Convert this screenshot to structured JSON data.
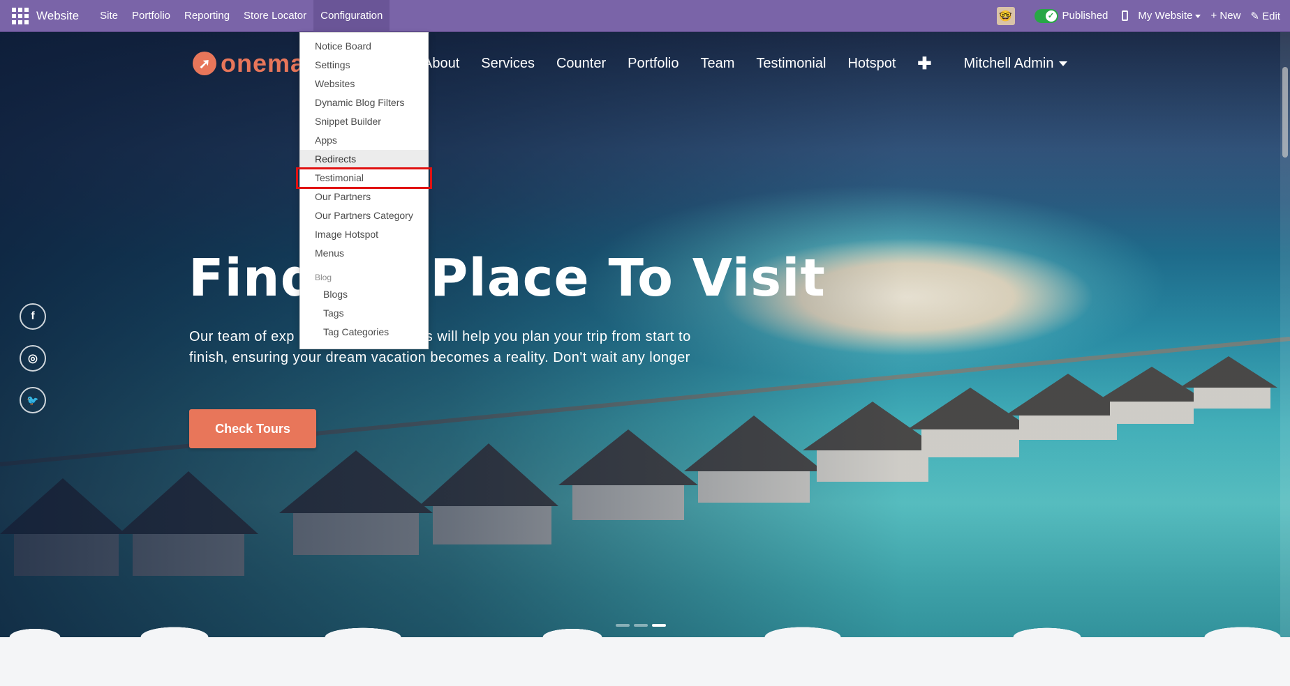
{
  "topbar": {
    "app_name": "Website",
    "nav": [
      "Site",
      "Portfolio",
      "Reporting",
      "Store Locator",
      "Configuration"
    ],
    "published_label": "Published",
    "website_selector": "My Website",
    "new_label": "+ New",
    "edit_label": "✎ Edit"
  },
  "site": {
    "logo_text": "onema",
    "nav": [
      "About",
      "Services",
      "Counter",
      "Portfolio",
      "Team",
      "Testimonial",
      "Hotspot"
    ],
    "add_label": "✚",
    "user": "Mitchell Admin"
  },
  "hero": {
    "title": "Find      Place To Visit",
    "text": "Our team of exp                         perts will help you plan your trip from start to finish, ensuring your dream vacation becomes a reality. Don't wait any longer",
    "cta": "Check Tours",
    "carousel_slides": 3,
    "active_slide": 3
  },
  "social": [
    {
      "icon": "facebook-icon",
      "glyph": "f"
    },
    {
      "icon": "instagram-icon",
      "glyph": "◎"
    },
    {
      "icon": "twitter-icon",
      "glyph": "🐦"
    }
  ],
  "configuration_menu": {
    "items": [
      "Notice Board",
      "Settings",
      "Websites",
      "Dynamic Blog Filters",
      "Snippet Builder",
      "Apps",
      "Redirects",
      "Testimonial",
      "Our Partners",
      "Our Partners Category",
      "Image Hotspot",
      "Menus"
    ],
    "hovered": "Redirects",
    "highlighted": "Testimonial",
    "section_label": "Blog",
    "section_items": [
      "Blogs",
      "Tags",
      "Tag Categories"
    ]
  },
  "colors": {
    "topbar": "#7a64a8",
    "accent": "#e8765a",
    "highlight_box": "#e01212",
    "published_toggle": "#28a745"
  }
}
